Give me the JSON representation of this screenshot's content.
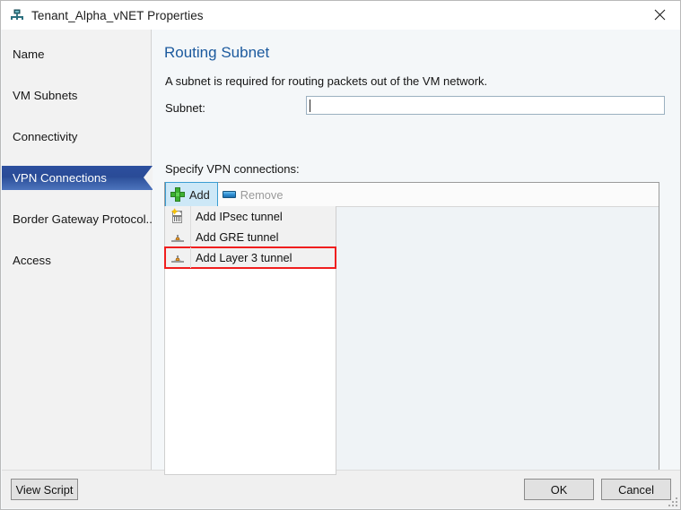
{
  "window": {
    "title": "Tenant_Alpha_vNET Properties",
    "icon": "network-subnet-icon",
    "close_icon": "close-icon"
  },
  "sidebar": {
    "items": [
      {
        "label": "Name",
        "selected": false
      },
      {
        "label": "VM Subnets",
        "selected": false
      },
      {
        "label": "Connectivity",
        "selected": false
      },
      {
        "label": "VPN Connections",
        "selected": true
      },
      {
        "label": "Border Gateway Protocol...",
        "selected": false
      },
      {
        "label": "Access",
        "selected": false
      }
    ],
    "selected_index": 3
  },
  "main": {
    "page_title": "Routing Subnet",
    "description": "A subnet is required for routing packets out of the VM network.",
    "subnet_label": "Subnet:",
    "subnet_value": "",
    "subnet_placeholder": "",
    "specify_label": "Specify VPN connections:"
  },
  "toolbar": {
    "add_label": "Add",
    "add_icon": "plus-icon",
    "add_active": true,
    "remove_label": "Remove",
    "remove_icon": "minus-dash-icon",
    "remove_enabled": false
  },
  "menu": {
    "open": true,
    "items": [
      {
        "label": "Add IPsec tunnel",
        "icon": "ipsec-tunnel-icon",
        "highlighted": false
      },
      {
        "label": "Add GRE tunnel",
        "icon": "gre-tunnel-icon",
        "highlighted": false
      },
      {
        "label": "Add Layer 3 tunnel",
        "icon": "layer3-tunnel-icon",
        "highlighted": true
      }
    ]
  },
  "list": {
    "rows": []
  },
  "footer": {
    "view_script_label": "View Script",
    "ok_label": "OK",
    "cancel_label": "Cancel"
  },
  "colors": {
    "accent_blue": "#1c5a9e",
    "selection_blue": "#2c4f9e",
    "highlight_red": "#f01e1e",
    "toolbar_active": "#cde8f7",
    "dialog_bg": "#f4f7f9",
    "sidebar_bg": "#f2f2f2",
    "list_bg": "#eff3f6"
  }
}
